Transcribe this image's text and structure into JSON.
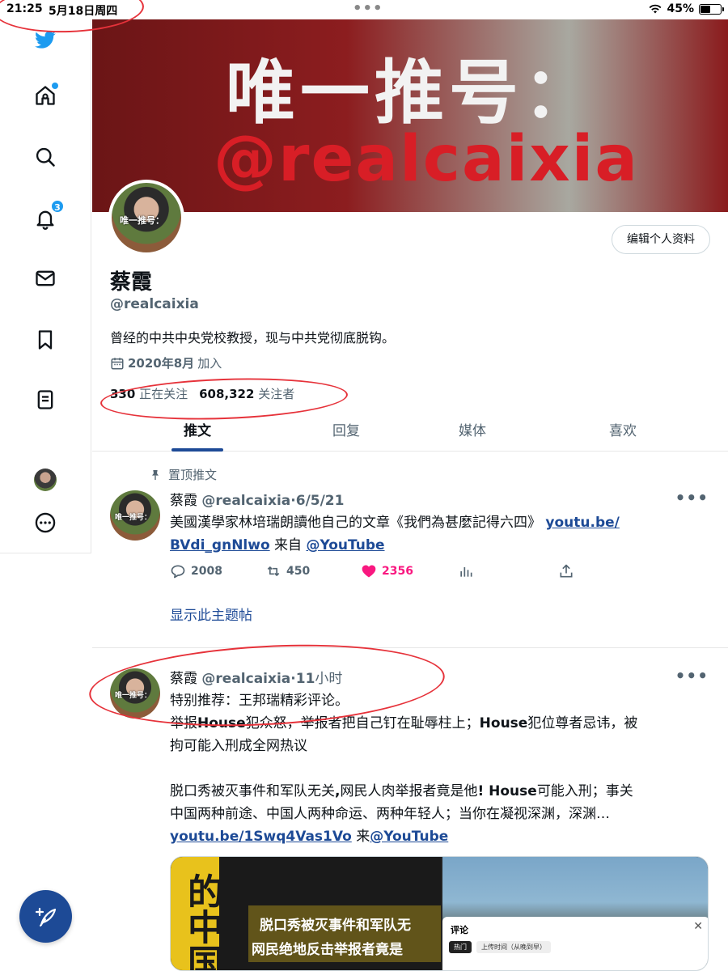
{
  "status_bar": {
    "time": "21:25",
    "date": "5月18日周四",
    "battery": "45%",
    "battery_level": 0.45
  },
  "sidebar": {
    "items": [
      {
        "name": "twitter-logo",
        "icon": "twitter-bird-icon"
      },
      {
        "name": "home",
        "icon": "home-icon",
        "badge_dot": true
      },
      {
        "name": "search",
        "icon": "search-icon"
      },
      {
        "name": "notifications",
        "icon": "bell-icon",
        "badge": "3"
      },
      {
        "name": "messages",
        "icon": "mail-icon"
      },
      {
        "name": "bookmarks",
        "icon": "bookmark-icon"
      },
      {
        "name": "lists",
        "icon": "list-icon"
      },
      {
        "name": "profile",
        "icon": "avatar"
      },
      {
        "name": "more",
        "icon": "more-circle-icon"
      }
    ],
    "compose_icon": "feather-plus-icon"
  },
  "banner": {
    "line1": "唯一推号：",
    "line2": "@realcaixia"
  },
  "profile": {
    "avatar_text": "唯一推号：",
    "edit_button": "编辑个人资料",
    "name": "蔡霞",
    "handle": "@realcaixia",
    "bio": "曾经的中共中央党校教授，现与中共党彻底脱钩。",
    "joined_date": "2020年8月",
    "joined_suffix": "加入",
    "following_count": "330",
    "following_label": "正在关注",
    "followers_count": "608,322",
    "followers_label": "关注者"
  },
  "tabs": [
    {
      "label": "推文",
      "active": true
    },
    {
      "label": "回复",
      "active": false
    },
    {
      "label": "媒体",
      "active": false
    },
    {
      "label": "喜欢",
      "active": false
    }
  ],
  "pinned_tweet": {
    "pinned_label": "置顶推文",
    "avatar_text": "唯一推号：",
    "name": "蔡霞",
    "handle": "@realcaixia",
    "sep": "·",
    "date": "6/5/21",
    "text_before_link": "美國漢學家林培瑞朗讀他自己的文章《我們為甚麼記得六四》",
    "link1a": "youtu.be/",
    "link1b": "BVdi_gnNlwo",
    "from_label": "来自",
    "link2": "@YouTube",
    "reply_count": "2008",
    "retweet_count": "450",
    "like_count": "2356",
    "show_thread": "显示此主题帖"
  },
  "tweet2": {
    "avatar_text": "唯一推号：",
    "name": "蔡霞",
    "handle": "@realcaixia",
    "sep": "·",
    "time_num": "11",
    "time_unit": "小时",
    "line1": "特别推荐：王邦瑞精彩评论。",
    "line2_a": "举报",
    "line2_b": "House",
    "line2_c": "犯众怒，举报者把自己钉在耻辱柱上；",
    "line2_d": "House",
    "line2_e": "犯位尊者忌讳，被",
    "line3": "拘可能入刑成全网热议",
    "line4_a": "脱口秀被灭事件和军队无关",
    "line4_b": ",",
    "line4_c": "网民人肉举报者竟是他",
    "line4_d": "! House",
    "line4_e": "可能入刑；事关",
    "line5": "中国两种前途、中国人两种命运、两种年轻人；当你在凝视深渊，深渊…",
    "link1": "youtu.be/1Swq4Vas1Vo",
    "from_label": "来",
    "link2": "@YouTube"
  },
  "video_card": {
    "left_big_text": "的中国",
    "left_line1": "脱口秀被灭事件和军队无",
    "left_line2": "网民绝地反击举报者竟是",
    "sheet_title": "评论",
    "sheet_tab1": "热门",
    "sheet_tab2": "上传时间（从晚到早）"
  }
}
